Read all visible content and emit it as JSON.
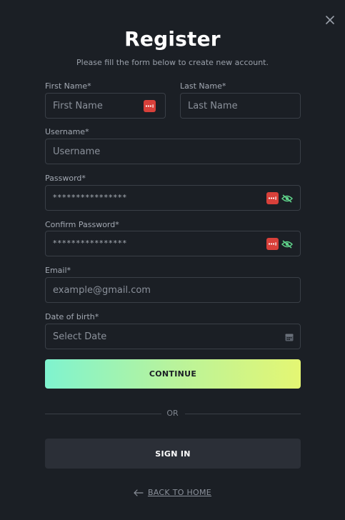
{
  "modal": {
    "title": "Register",
    "subtitle": "Please fill the form below to create new account."
  },
  "fields": {
    "first_name": {
      "label": "First Name*",
      "placeholder": "First Name"
    },
    "last_name": {
      "label": "Last Name*",
      "placeholder": "Last Name"
    },
    "username": {
      "label": "Username*",
      "placeholder": "Username"
    },
    "password": {
      "label": "Password*",
      "value": "****************"
    },
    "confirm_password": {
      "label": "Confirm Password*",
      "value": "****************"
    },
    "email": {
      "label": "Email*",
      "placeholder": "example@gmail.com"
    },
    "dob": {
      "label": "Date of birth*",
      "placeholder": "Select Date"
    }
  },
  "buttons": {
    "continue_label": "CONTINUE",
    "signin_label": "SIGN IN",
    "back_label": "BACK TO HOME"
  },
  "divider": {
    "or_label": "OR"
  },
  "icons": {
    "close": "close-icon",
    "password_manager": "password-manager-icon",
    "eye": "eye-icon",
    "calendar": "calendar-icon",
    "arrow_left": "arrow-left-icon"
  },
  "colors": {
    "background": "#1b1f25",
    "gradient_start": "#7ff3cf",
    "gradient_end": "#e4f673",
    "password_manager": "#d8403a",
    "eye": "#5fd38a"
  }
}
